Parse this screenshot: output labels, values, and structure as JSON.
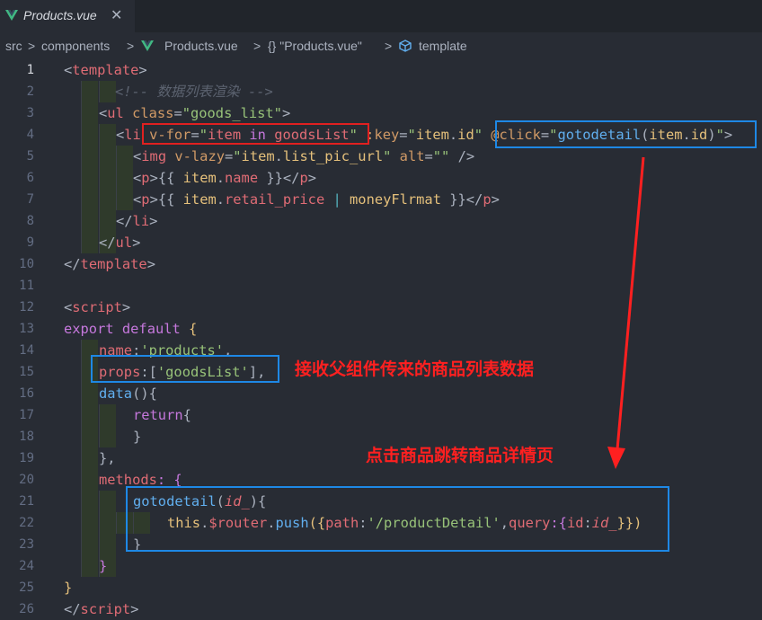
{
  "tab": {
    "title": "Products.vue",
    "close": "✕",
    "icon": "vue-icon"
  },
  "breadcrumb": {
    "items": [
      "src",
      "components",
      "Products.vue",
      "{} \"Products.vue\"",
      "template"
    ],
    "separator": ">"
  },
  "gutter": {
    "line_numbers": [
      "1",
      "2",
      "3",
      "4",
      "5",
      "6",
      "7",
      "8",
      "9",
      "10",
      "11",
      "12",
      "13",
      "14",
      "15",
      "16",
      "17",
      "18",
      "19",
      "20",
      "21",
      "22",
      "23",
      "24",
      "25",
      "26"
    ],
    "active_line": "1"
  },
  "code": {
    "l1": [
      "<",
      "template",
      ">"
    ],
    "l2": "<!-- 数据列表渲染 -->",
    "l3": [
      "<",
      "ul",
      " ",
      "class",
      "=",
      "\"goods_list\"",
      ">"
    ],
    "l4": [
      "<",
      "li",
      " ",
      "v-for",
      "=",
      "\"",
      "item",
      " ",
      "in",
      " ",
      "goodsList",
      "\"",
      " ",
      ":key",
      "=",
      "\"",
      "item",
      ".",
      "id",
      "\"",
      " ",
      "@click",
      "=",
      "\"",
      "gotodetail",
      "(",
      "item",
      ".",
      "id",
      ")",
      "\"",
      ">"
    ],
    "l5": [
      "<",
      "img",
      " ",
      "v-lazy",
      "=",
      "\"",
      "item",
      ".",
      "list_pic_url",
      "\"",
      " ",
      "alt",
      "=",
      "\"\"",
      " />"
    ],
    "l6": [
      "<",
      "p",
      ">",
      "{{ ",
      "item",
      ".",
      "name",
      " }}",
      "</",
      "p",
      ">"
    ],
    "l7": [
      "<",
      "p",
      ">",
      "{{ ",
      "item",
      ".",
      "retail_price",
      " | ",
      "moneyFlrmat",
      " }}",
      "</",
      "p",
      ">"
    ],
    "l8": [
      "</",
      "li",
      ">"
    ],
    "l9": [
      "</",
      "ul",
      ">"
    ],
    "l10": [
      "</",
      "template",
      ">"
    ],
    "l12": [
      "<",
      "script",
      ">"
    ],
    "l13": [
      "export",
      " ",
      "default",
      " {"
    ],
    "l14": [
      "name",
      ":",
      "'products'",
      ","
    ],
    "l15": [
      "props",
      ":[",
      "'goodsList'",
      "],"
    ],
    "l16": [
      "data",
      "(){"
    ],
    "l17": [
      "return",
      "{"
    ],
    "l18": "}",
    "l19": "},",
    "l20": [
      "methods",
      ": {"
    ],
    "l21": [
      "gotodetail",
      "(",
      "id_",
      "){"
    ],
    "l22": [
      "this",
      ".",
      "$router",
      ".",
      "push",
      "({",
      "path",
      ":",
      "'/productDetail'",
      ",",
      "query",
      ":{",
      "id",
      ":",
      "id_",
      "}})"
    ],
    "l23": "}",
    "l24": "}",
    "l25": "}",
    "l26": [
      "</",
      "script",
      ">"
    ]
  },
  "annotations": {
    "props_note": "接收父组件传来的商品列表数据",
    "click_note": "点击商品跳转商品详情页"
  },
  "colors": {
    "tag": "#e06c75",
    "attr": "#d19a66",
    "string": "#98c379",
    "keyword": "#c678dd",
    "function": "#61afef",
    "red_box": "#e02020",
    "blue_box": "#1e88e5",
    "note": "#ff2020"
  }
}
